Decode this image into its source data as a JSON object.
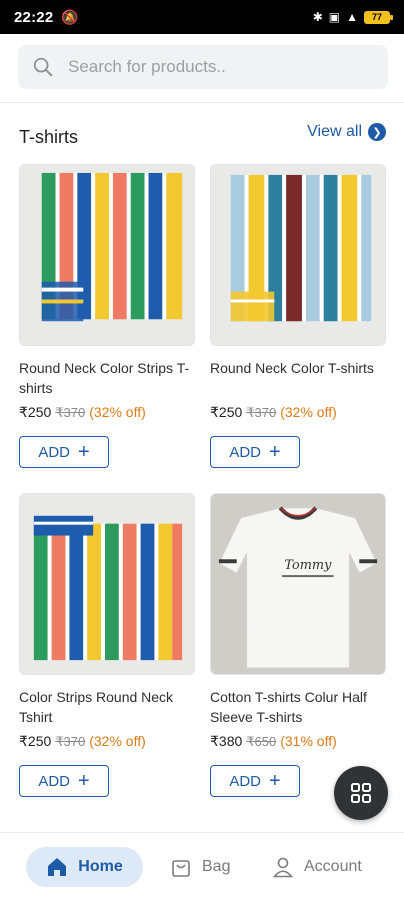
{
  "status_bar": {
    "time": "22:22",
    "battery": "77",
    "icons": [
      "mute-bell-icon",
      "bluetooth-icon",
      "vibrate-icon",
      "signal-icon",
      "battery-icon"
    ]
  },
  "search": {
    "placeholder": "Search for products..",
    "value": ""
  },
  "section": {
    "title": "T-shirts",
    "view_all": "View all"
  },
  "products": [
    {
      "name": "Round Neck Color Strips T-shirts",
      "price": "₹250",
      "mrp": "₹370",
      "discount": "(32% off)",
      "add_label": "ADD"
    },
    {
      "name": "Round Neck Color T-shirts",
      "price": "₹250",
      "mrp": "₹370",
      "discount": "(32% off)",
      "add_label": "ADD"
    },
    {
      "name": "Color Strips Round Neck Tshirt",
      "price": "₹250",
      "mrp": "₹370",
      "discount": "(32% off)",
      "add_label": "ADD"
    },
    {
      "name": "Cotton T-shirts Colur Half Sleeve T-shirts",
      "price": "₹380",
      "mrp": "₹650",
      "discount": "(31% off)",
      "add_label": "ADD"
    }
  ],
  "bottom_nav": {
    "home": "Home",
    "bag": "Bag",
    "account": "Account"
  },
  "colors": {
    "accent": "#1d5ba8",
    "discount": "#e07b17",
    "home_pill": "#dde9f7"
  }
}
